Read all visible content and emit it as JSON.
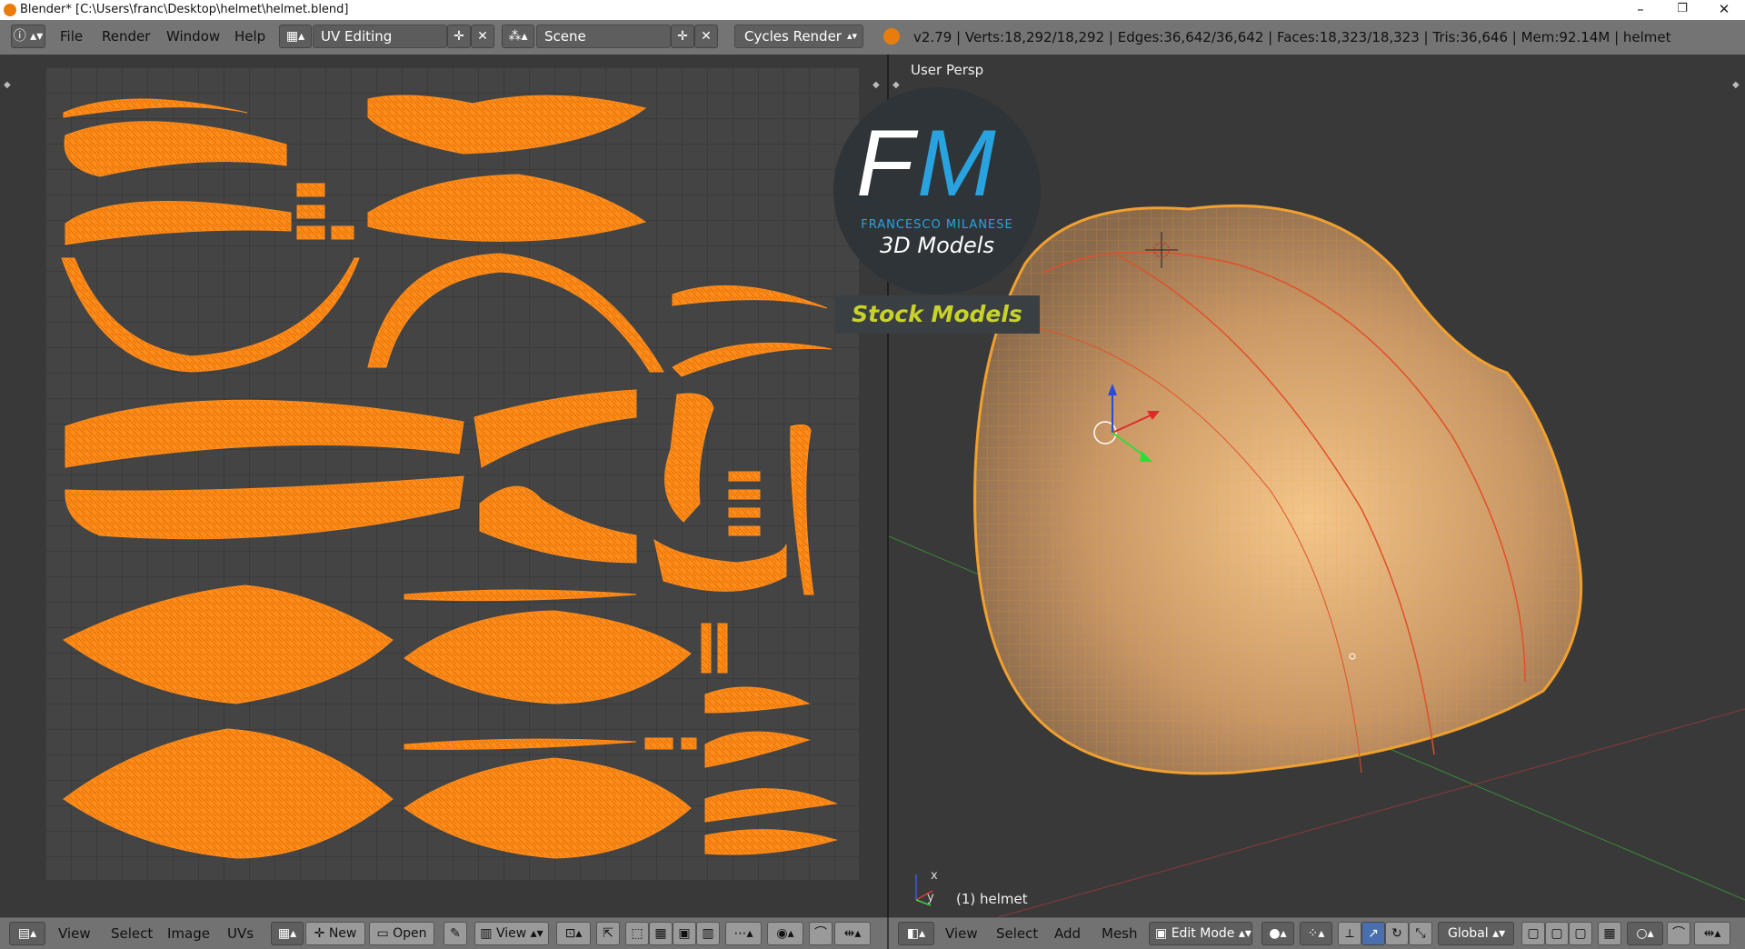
{
  "window": {
    "title": "Blender* [C:\\Users\\franc\\Desktop\\helmet\\helmet.blend]",
    "min_glyph": "–",
    "max_glyph": "❐",
    "close_glyph": "✕"
  },
  "info_header": {
    "menus": [
      "File",
      "Render",
      "Window",
      "Help"
    ],
    "screen_layout": "UV Editing",
    "scene": "Scene",
    "render_engine": "Cycles Render",
    "stats": "v2.79 | Verts:18,292/18,292 | Edges:36,642/36,642 | Faces:18,323/18,323 | Tris:36,646 | Mem:92.14M | helmet"
  },
  "uv_editor": {
    "header_menus": [
      "View",
      "Select",
      "Image",
      "UVs"
    ],
    "new_label": "New",
    "open_label": "Open",
    "view_label": "View"
  },
  "viewport": {
    "view_name": "User Persp",
    "object_label": "(1) helmet",
    "header_menus": [
      "View",
      "Select",
      "Add",
      "Mesh"
    ],
    "mode": "Edit Mode",
    "orientation": "Global",
    "axis_x": "x",
    "axis_y": "y"
  },
  "watermark": {
    "brand_f": "F",
    "brand_m": "M",
    "name": "FRANCESCO MILANESE",
    "tagline": "3D Models",
    "stock": "Stock Models"
  },
  "colors": {
    "uv_orange": "#ff8c1a",
    "mesh_orange": "#f0a030",
    "brand_blue": "#29a3e0",
    "stock_yellow": "#c8d228"
  },
  "icons": [
    "blender-logo-icon",
    "info-editor-icon",
    "screen-layout-icon",
    "scene-icon",
    "add-icon",
    "close-icon",
    "image-editor-icon",
    "3d-view-icon",
    "sphere-icon",
    "manipulator-icon"
  ]
}
